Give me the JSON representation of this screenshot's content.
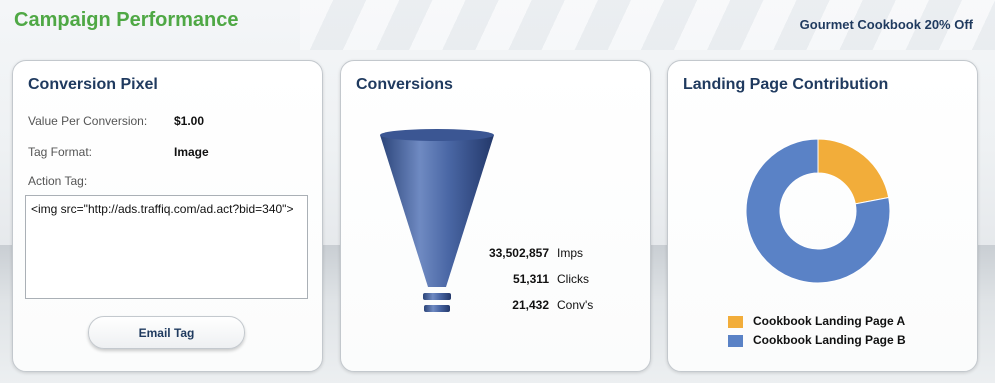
{
  "header": {
    "title": "Campaign Performance",
    "campaign_name": "Gourmet Cookbook 20% Off"
  },
  "pixel_panel": {
    "title": "Conversion Pixel",
    "value_per_conversion_label": "Value Per Conversion:",
    "value_per_conversion": "$1.00",
    "tag_format_label": "Tag Format:",
    "tag_format": "Image",
    "action_tag_label": "Action Tag:",
    "action_tag_value": "<img src=\"http://ads.traffiq.com/ad.act?bid=340\">",
    "email_button_label": "Email Tag"
  },
  "conversions_panel": {
    "title": "Conversions",
    "metrics": [
      {
        "value": "33,502,857",
        "label": "Imps"
      },
      {
        "value": "51,311",
        "label": "Clicks"
      },
      {
        "value": "21,432",
        "label": "Conv's"
      }
    ],
    "funnel_color": "#3f5c99"
  },
  "landing_panel": {
    "title": "Landing Page Contribution",
    "chart_data": {
      "type": "pie",
      "labels": [
        "Cookbook Landing Page A",
        "Cookbook Landing Page B"
      ],
      "values": [
        22,
        78
      ],
      "colors": [
        "#f2ad3a",
        "#5a82c6"
      ],
      "legend_position": "bottom"
    }
  }
}
